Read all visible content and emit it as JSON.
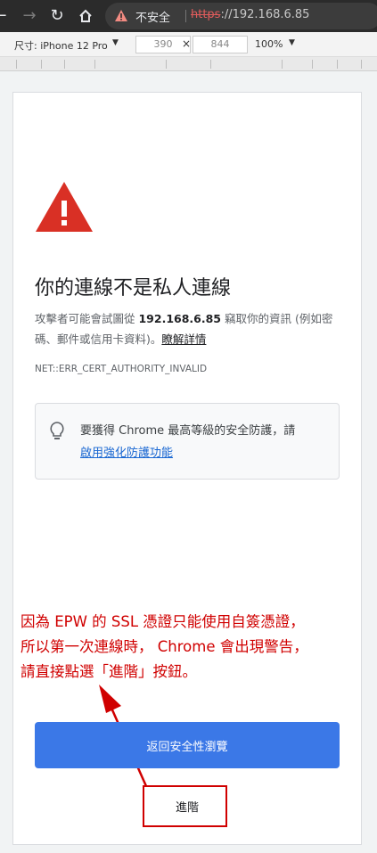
{
  "browser": {
    "security_label": "不安全",
    "url_scheme": "https",
    "url_rest": "://192.168.6.85"
  },
  "device_toolbar": {
    "device_label": "尺寸: iPhone 12 Pro",
    "width": "390",
    "height": "844",
    "separator": "×",
    "zoom": "100%"
  },
  "page": {
    "heading": "你的連線不是私人連線",
    "desc_before": "攻擊者可能會試圖從 ",
    "desc_host": "192.168.6.85",
    "desc_after": " 竊取你的資訊 (例如密碼、郵件或信用卡資料)。",
    "learn_more": "瞭解詳情",
    "error_code": "NET::ERR_CERT_AUTHORITY_INVALID",
    "tip_text": "要獲得 Chrome 最高等級的安全防護，請",
    "tip_link": "啟用強化防護功能",
    "back_button": "返回安全性瀏覽",
    "advanced_button": "進階"
  },
  "annotation": {
    "line1": "因為 EPW 的 SSL 憑證只能使用自簽憑證，",
    "line2": "所以第一次連線時， Chrome 會出現警告，",
    "line3": "請直接點選「進階」按鈕。"
  },
  "colors": {
    "warning_red": "#d93025",
    "annotation_red": "#d00000",
    "primary_blue": "#3b78e7",
    "link_blue": "#1967d2"
  }
}
